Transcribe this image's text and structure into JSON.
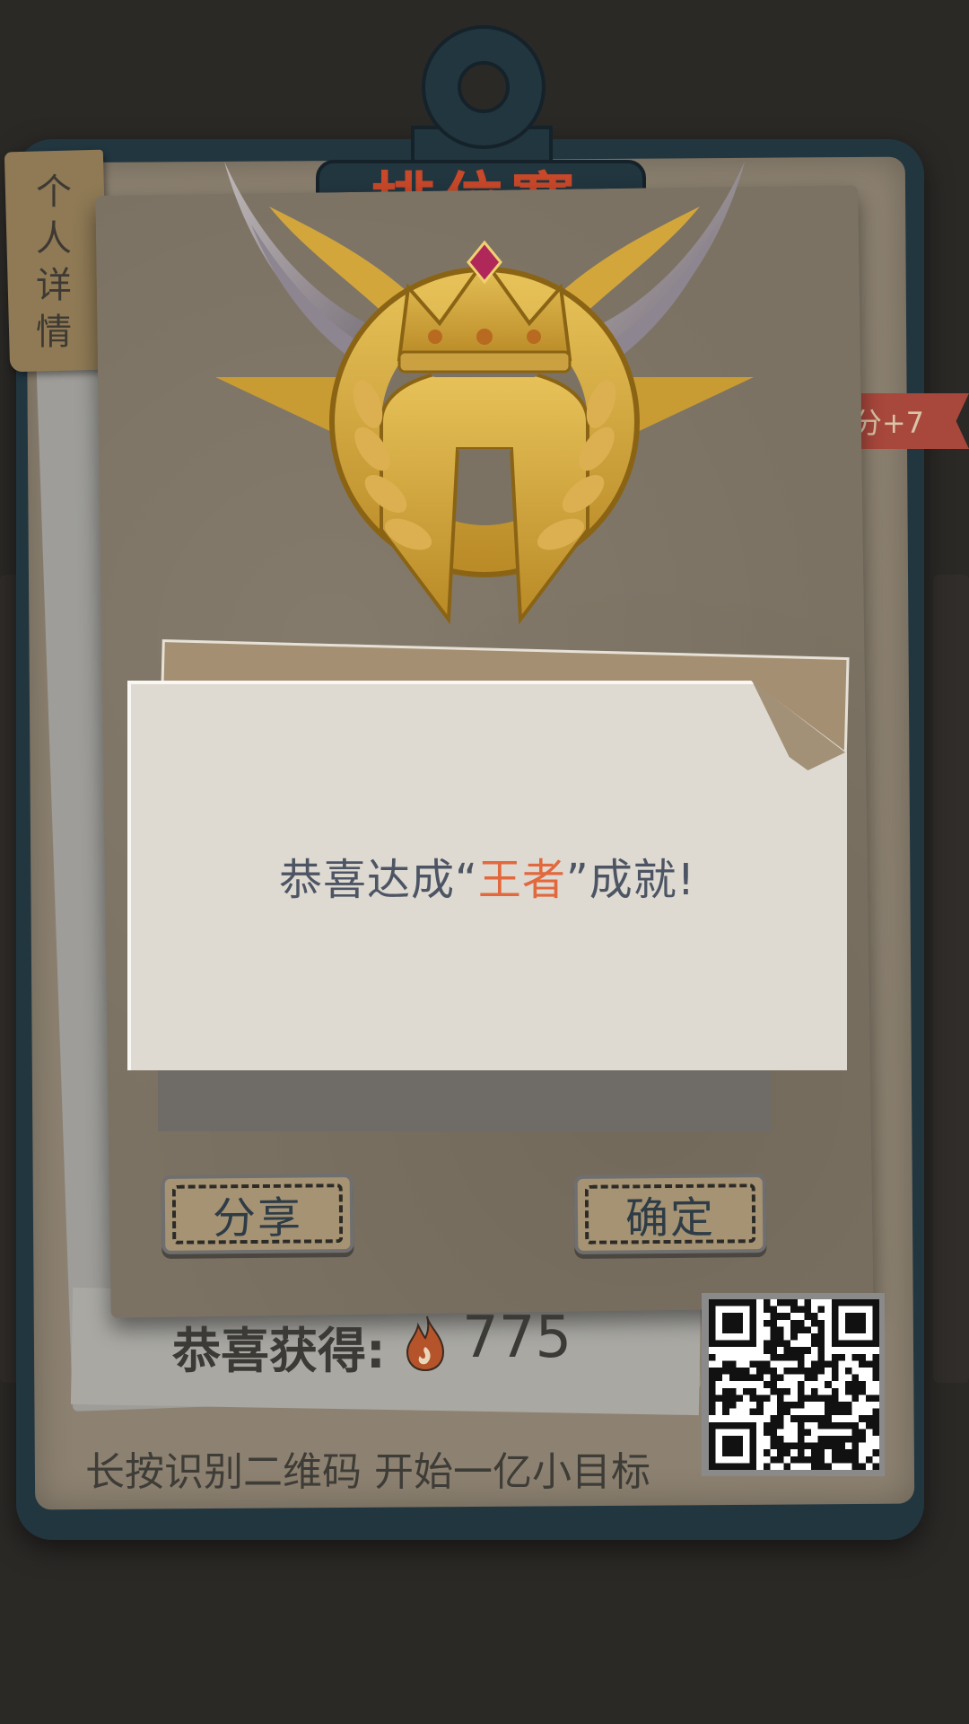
{
  "header": {
    "title": "排位赛",
    "side_tab_label": "个人详情",
    "ribbon_text": "分+7"
  },
  "achievement": {
    "message_prefix": "恭喜达成“",
    "title": "王者",
    "message_suffix": "”成就!"
  },
  "buttons": {
    "share_label": "分享",
    "confirm_label": "确定"
  },
  "reward": {
    "label": "恭喜获得:",
    "icon": "flame-icon",
    "value": "775"
  },
  "footer": {
    "text": "长按识别二维码 开始一亿小目标"
  },
  "colors": {
    "highlight": "#e2683d",
    "board": "#223640",
    "title_red": "#c8482a"
  }
}
